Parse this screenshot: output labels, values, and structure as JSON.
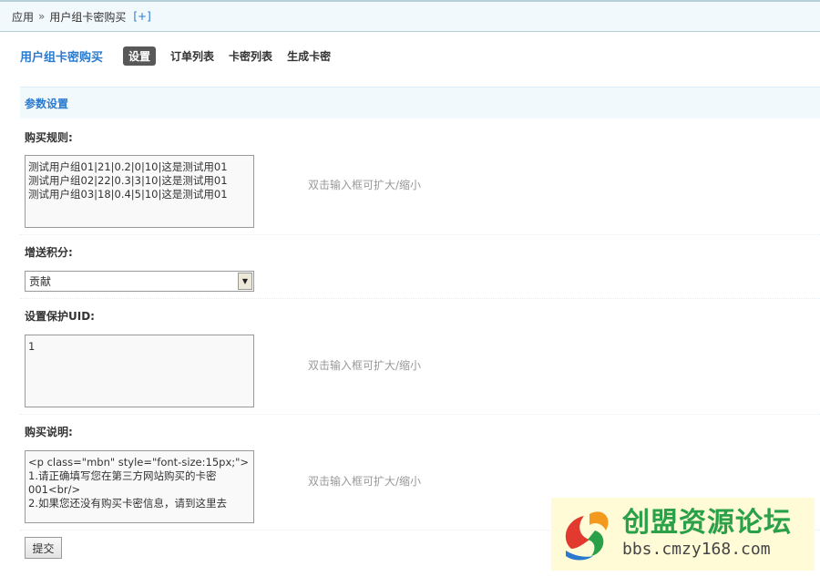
{
  "breadcrumb": {
    "root": "应用",
    "separator": "»",
    "current": "用户组卡密购买",
    "add_label": "[+]"
  },
  "header": {
    "title": "用户组卡密购买",
    "tabs": [
      {
        "label": "设置",
        "active": true
      },
      {
        "label": "订单列表",
        "active": false
      },
      {
        "label": "卡密列表",
        "active": false
      },
      {
        "label": "生成卡密",
        "active": false
      }
    ]
  },
  "section": {
    "title": "参数设置"
  },
  "fields": {
    "purchase_rules": {
      "label": "购买规则:",
      "value": "测试用户组01|21|0.2|0|10|这是测试用01\n测试用户组02|22|0.3|3|10|这是测试用01\n测试用户组03|18|0.4|5|10|这是测试用01",
      "hint": "双击输入框可扩大/缩小"
    },
    "bonus_credit": {
      "label": "增送积分:",
      "value": "贡献"
    },
    "protect_uid": {
      "label": "设置保护UID:",
      "value": "1",
      "hint": "双击输入框可扩大/缩小"
    },
    "purchase_notes": {
      "label": "购买说明:",
      "value": "<p class=\"mbn\" style=\"font-size:15px;\">\n1.请正确填写您在第三方网站购买的卡密001<br/>\n2.如果您还没有购买卡密信息，请到这里去",
      "hint": "双击输入框可扩大/缩小"
    }
  },
  "submit_label": "提交",
  "watermark": {
    "title": "创盟资源论坛",
    "url": "bbs.cmzy168.com"
  },
  "colors": {
    "accent": "#2b7acd",
    "section_bg": "#f2f9fd",
    "tab_active_bg": "#585858",
    "watermark_green": "#2aa049"
  }
}
